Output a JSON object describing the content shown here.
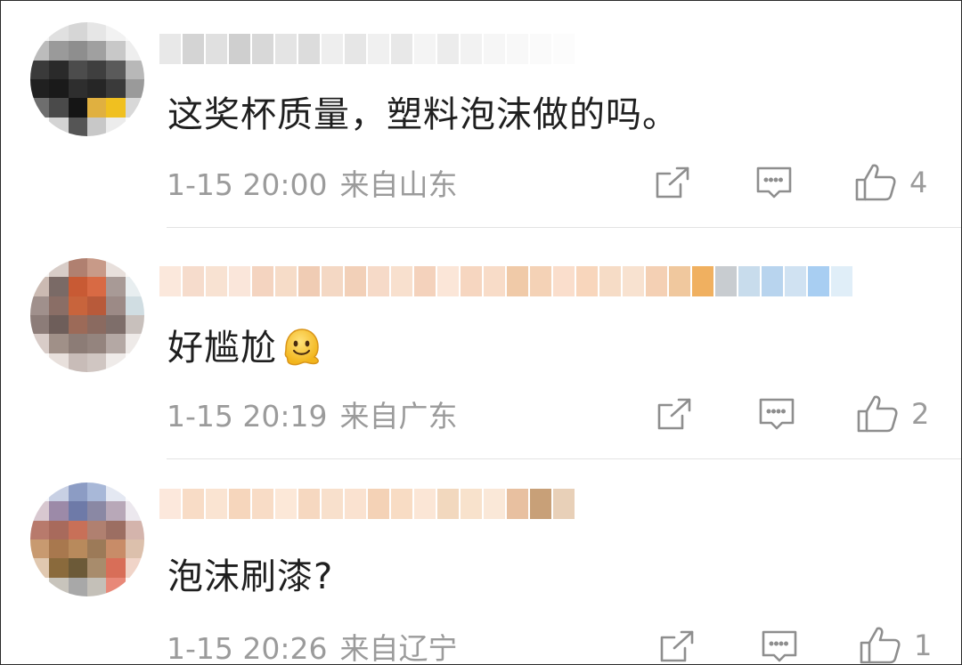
{
  "comments": [
    {
      "text": "这奖杯质量，塑料泡沫做的吗。",
      "time": "1-15 20:00",
      "location": "来自山东",
      "likes": "4",
      "avatar_colors": [
        "#f4f4f4",
        "#e0e0e0",
        "#d6d6d6",
        "#e6e6e6",
        "#f2f2f2",
        "#fafafa",
        "#bcbcbc",
        "#9a9a9a",
        "#8e8e8e",
        "#a0a0a0",
        "#c8c8c8",
        "#eeeeee",
        "#3a3a3a",
        "#2a2a2a",
        "#4c4c4c",
        "#3f3f3f",
        "#5a5a5a",
        "#b8b8b8",
        "#202020",
        "#1a1a1a",
        "#2e2e2e",
        "#262626",
        "#3a3a3a",
        "#9a9a9a",
        "#6e6e6e",
        "#4a4a4a",
        "#151515",
        "#e0b040",
        "#f0c020",
        "#d8d8d8",
        "#f8f8f8",
        "#d4d4d4",
        "#555555",
        "#c8c8c8",
        "#ececec",
        "#fcfcfc"
      ],
      "name_colors": [
        "#e8e8e8",
        "#d4d4d4",
        "#e0e0e0",
        "#cfcfcf",
        "#d8d8d8",
        "#e4e4e4",
        "#dcdcdc",
        "#eeeeee",
        "#e6e6e6",
        "#f0f0f0",
        "#e8e8e8",
        "#f4f4f4",
        "#ececec",
        "#f2f2f2",
        "#f6f6f6",
        "#f8f8f8",
        "#fafafa",
        "#fcfcfc"
      ]
    },
    {
      "text": "好尴尬",
      "has_emoji": true,
      "time": "1-15 20:19",
      "location": "来自广东",
      "likes": "2",
      "avatar_colors": [
        "#f6f4f2",
        "#d8cdc8",
        "#b08070",
        "#c89a88",
        "#e8e0dc",
        "#fbfaf9",
        "#cbbab2",
        "#7a6a66",
        "#c85a34",
        "#d86a44",
        "#a89a96",
        "#e8eef0",
        "#a0908c",
        "#8a6e66",
        "#c8643c",
        "#b85a3a",
        "#9c8a86",
        "#d0dde2",
        "#8c7c78",
        "#6e5e5a",
        "#9c6a58",
        "#8a6a60",
        "#7e6e6a",
        "#c8c0bc",
        "#d8ccc8",
        "#a09088",
        "#8c7c76",
        "#94847e",
        "#b4a8a4",
        "#eeeae8",
        "#fbfaf9",
        "#e8e0dc",
        "#c8bcb8",
        "#d0c6c2",
        "#efebe9",
        "#fdfcfc"
      ],
      "name_colors": [
        "#fbe8dc",
        "#f6dccc",
        "#f8e2d2",
        "#fae6da",
        "#f4d4c0",
        "#f6dcc8",
        "#f0ccb4",
        "#f4d8c4",
        "#f2d0b8",
        "#f6dac8",
        "#f8e0ce",
        "#f4d2bc",
        "#fbe6d8",
        "#f6d6c0",
        "#f8dcc8",
        "#f0caa8",
        "#f4d2b6",
        "#fadecc",
        "#f8d6bc",
        "#f6dcc6",
        "#f8e2d0",
        "#f4d0b4",
        "#f0c89e",
        "#f0b060",
        "#c8ccd0",
        "#c8dcec",
        "#b8d4ee",
        "#d0e2f2",
        "#a8cef2",
        "#e0eef8"
      ]
    },
    {
      "text": "泡沫刷漆?",
      "time": "1-15 20:26",
      "location": "来自辽宁",
      "likes": "1",
      "avatar_colors": [
        "#f4f6fa",
        "#c8d0e4",
        "#8c9cc4",
        "#a8b8d8",
        "#e4e8f2",
        "#fbfbfd",
        "#d8c8d0",
        "#9c8aa8",
        "#6e7aa8",
        "#8a88a4",
        "#b8a8b8",
        "#ece8ee",
        "#b87a6c",
        "#a86a5c",
        "#c87058",
        "#b08070",
        "#9c6e62",
        "#d4b4ac",
        "#c89a70",
        "#a8784e",
        "#b88a5c",
        "#9c7a58",
        "#c88c68",
        "#dcc0ac",
        "#e0c8b0",
        "#8a6a3c",
        "#6c5a38",
        "#a88c6c",
        "#d86e58",
        "#f0d4c8",
        "#fbfaf8",
        "#c8c4bc",
        "#a8a8a8",
        "#c4c0b8",
        "#e88878",
        "#fdf8f6"
      ],
      "name_colors": [
        "#fce8dc",
        "#f8dcc6",
        "#fae4d2",
        "#f6d6bc",
        "#f8dcc6",
        "#fce8d8",
        "#f6d8c0",
        "#f8e0cc",
        "#fae2d0",
        "#f4d2b6",
        "#f8dcc4",
        "#fbe6d6",
        "#f2d8be",
        "#f8e2cc",
        "#fae8d8",
        "#e8c0a0",
        "#c8a078",
        "#e8d0b8"
      ]
    }
  ],
  "icons": {
    "share": "share-icon",
    "reply": "comment-icon",
    "like": "thumbs-up-icon",
    "emoji": "melting-face-emoji"
  },
  "colors": {
    "meta_text": "#9b9b9b",
    "comment_text": "#1f1f1f",
    "divider": "#e3e3e3"
  }
}
